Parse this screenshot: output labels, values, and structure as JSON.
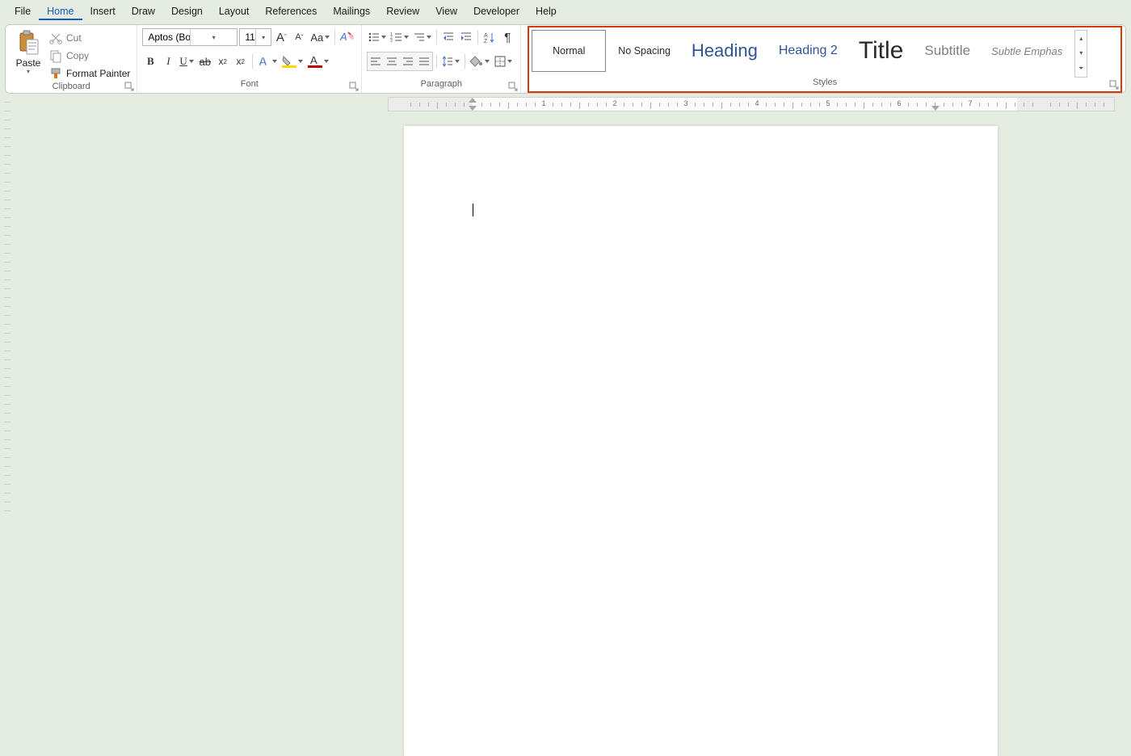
{
  "menu": {
    "items": [
      "File",
      "Home",
      "Insert",
      "Draw",
      "Design",
      "Layout",
      "References",
      "Mailings",
      "Review",
      "View",
      "Developer",
      "Help"
    ],
    "active_index": 1
  },
  "clipboard": {
    "paste_label": "Paste",
    "cut_label": "Cut",
    "copy_label": "Copy",
    "format_painter_label": "Format Painter",
    "group_label": "Clipboard"
  },
  "font": {
    "family": "Aptos (Body)",
    "size": "11",
    "case_label": "Aa",
    "group_label": "Font"
  },
  "paragraph": {
    "group_label": "Paragraph"
  },
  "styles": {
    "items": [
      {
        "label": "Normal",
        "class": "",
        "selected": true
      },
      {
        "label": "No Spacing",
        "class": ""
      },
      {
        "label": "Heading",
        "class": "style-heading"
      },
      {
        "label": "Heading 2",
        "class": "style-heading2"
      },
      {
        "label": "Title",
        "class": "style-title"
      },
      {
        "label": "Subtitle",
        "class": "style-subtitle"
      },
      {
        "label": "Subtle Emphas",
        "class": "style-emph"
      }
    ],
    "group_label": "Styles"
  },
  "ruler": {
    "numbers": [
      1,
      2,
      3,
      4,
      5,
      6,
      7
    ]
  }
}
